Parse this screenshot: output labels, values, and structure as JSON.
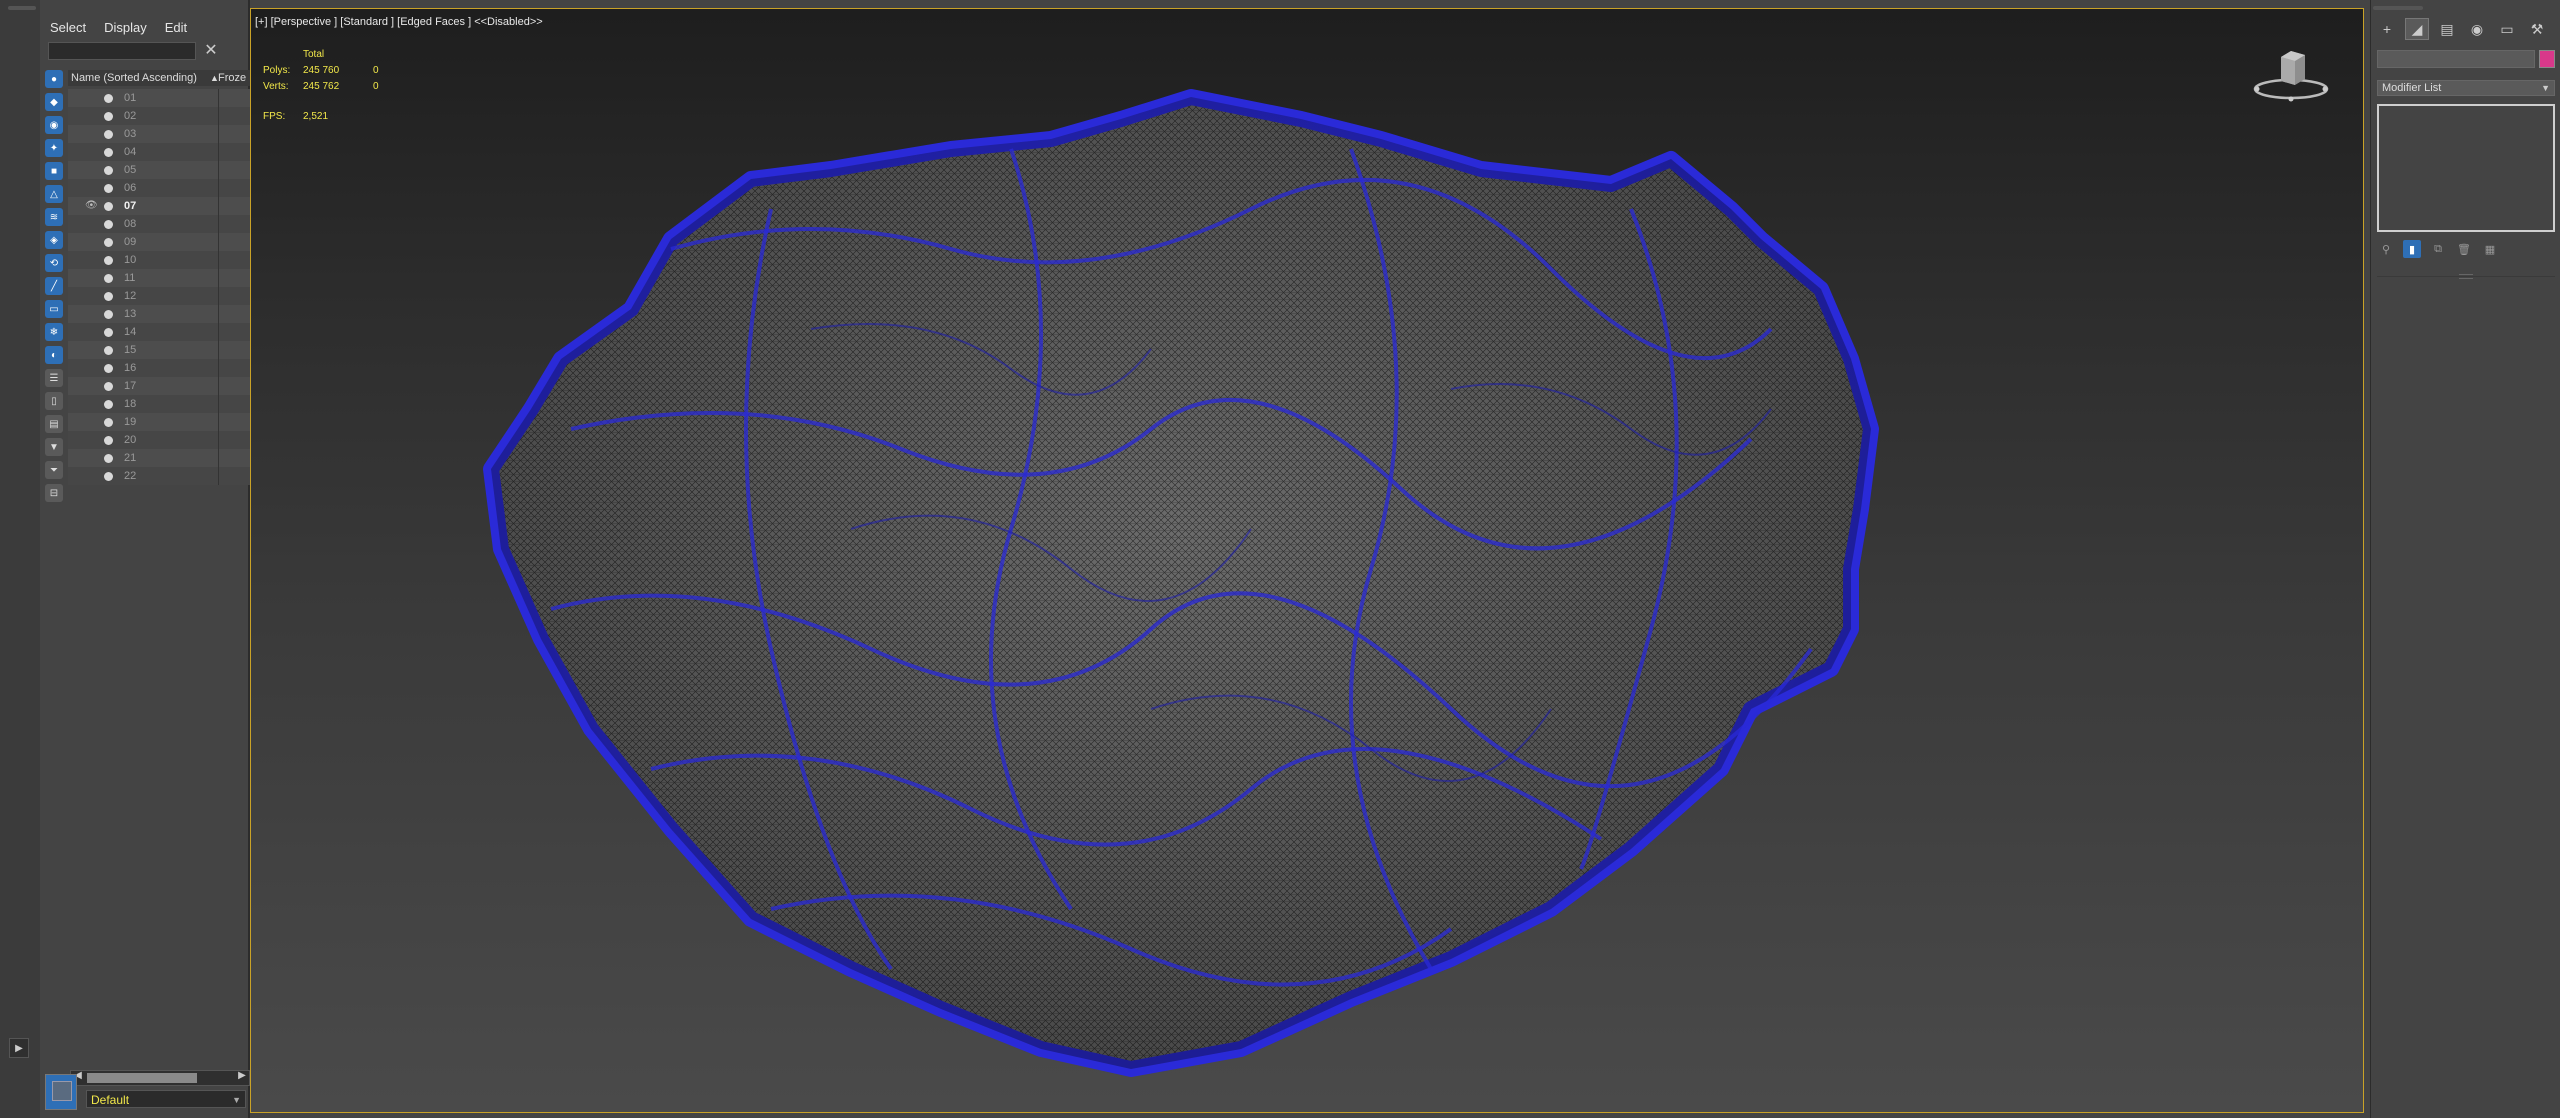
{
  "explorer": {
    "menu": [
      "Select",
      "Display",
      "Edit"
    ],
    "search_placeholder": "",
    "header_name": "Name (Sorted Ascending)",
    "header_sort": "▲",
    "header_frozen": "Froze",
    "rows": [
      "01",
      "02",
      "03",
      "04",
      "05",
      "06",
      "07",
      "08",
      "09",
      "10",
      "11",
      "12",
      "13",
      "14",
      "15",
      "16",
      "17",
      "18",
      "19",
      "20",
      "21",
      "22"
    ],
    "active_row": "07",
    "layer_name": "Default"
  },
  "viewport": {
    "label": "[+] [Perspective ] [Standard ] [Edged Faces ]  <<Disabled>>",
    "stats": {
      "total_label": "Total",
      "polys_label": "Polys:",
      "polys_total": "245 760",
      "polys_sel": "0",
      "verts_label": "Verts:",
      "verts_total": "245 762",
      "verts_sel": "0",
      "fps_label": "FPS:",
      "fps_value": "2,521"
    },
    "wire_color": "#2a2ad8"
  },
  "command_panel": {
    "modifier_list": "Modifier List",
    "object_color": "#d8388a"
  }
}
